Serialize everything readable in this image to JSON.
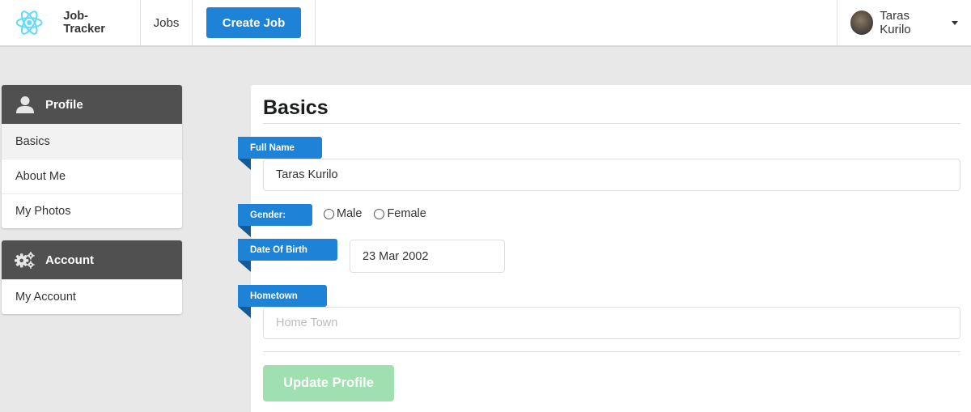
{
  "nav": {
    "brand": "Job-Tracker",
    "brand_icon": "react-atom-icon",
    "jobs_label": "Jobs",
    "create_job_label": "Create Job",
    "user_name": "Taras Kurilo",
    "accent_color": "#1e82d6"
  },
  "sidebar": {
    "profile": {
      "title": "Profile",
      "icon": "user-icon",
      "items": [
        {
          "label": "Basics",
          "active": true
        },
        {
          "label": "About Me",
          "active": false
        },
        {
          "label": "My Photos",
          "active": false
        }
      ]
    },
    "account": {
      "title": "Account",
      "icon": "gears-icon",
      "items": [
        {
          "label": "My Account",
          "active": false
        }
      ]
    }
  },
  "main": {
    "title": "Basics",
    "full_name": {
      "label": "Full Name",
      "value": "Taras Kurilo",
      "placeholder": ""
    },
    "gender": {
      "label": "Gender:",
      "options": [
        "Male",
        "Female"
      ],
      "selected": null
    },
    "dob": {
      "label": "Date Of Birth",
      "value": "23 Mar 2002"
    },
    "hometown": {
      "label": "Hometown",
      "value": "",
      "placeholder": "Home Town"
    },
    "update_label": "Update Profile",
    "update_color": "#a0e0b0"
  }
}
